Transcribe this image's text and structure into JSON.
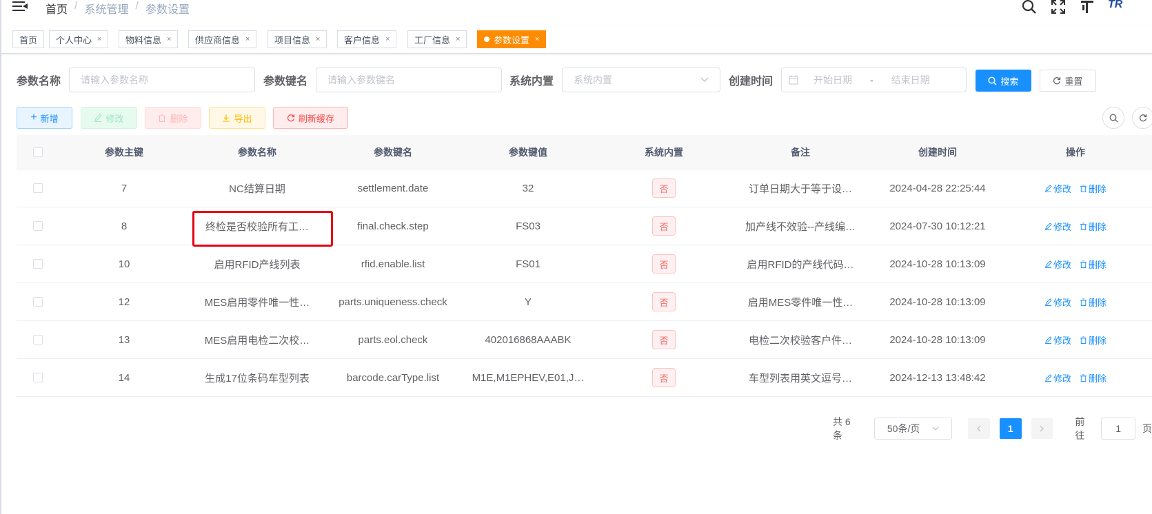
{
  "breadcrumb": {
    "home": "首页",
    "sep": "/",
    "level1": "系统管理",
    "level2": "参数设置"
  },
  "top_icons": [
    "search-icon",
    "fullscreen-icon",
    "font-size-icon"
  ],
  "logo": {
    "text": "TR"
  },
  "tags": [
    {
      "label": "首页",
      "closable": false,
      "active": false
    },
    {
      "label": "个人中心",
      "closable": true,
      "active": false
    },
    {
      "label": "物料信息",
      "closable": true,
      "active": false
    },
    {
      "label": "供应商信息",
      "closable": true,
      "active": false
    },
    {
      "label": "项目信息",
      "closable": true,
      "active": false
    },
    {
      "label": "客户信息",
      "closable": true,
      "active": false
    },
    {
      "label": "工厂信息",
      "closable": true,
      "active": false
    },
    {
      "label": "参数设置",
      "closable": true,
      "active": true
    }
  ],
  "tag_close": "×",
  "filters": {
    "config_name_label": "参数名称",
    "config_name_placeholder": "请输入参数名称",
    "config_key_label": "参数键名",
    "config_key_placeholder": "请输入参数键名",
    "config_type_label": "系统内置",
    "config_type_placeholder": "系统内置",
    "create_time_label": "创建时间",
    "start_date_placeholder": "开始日期",
    "date_sep": "-",
    "end_date_placeholder": "结束日期",
    "search_label": "搜索",
    "reset_label": "重置"
  },
  "toolbar": {
    "add": "新增",
    "edit": "修改",
    "delete": "删除",
    "export": "导出",
    "refresh_cache": "刷新缓存"
  },
  "table": {
    "headers": [
      "参数主键",
      "参数名称",
      "参数键名",
      "参数键值",
      "系统内置",
      "备注",
      "创建时间",
      "操作"
    ],
    "rows": [
      {
        "id": "7",
        "name": "NC结算日期",
        "key": "settlement.date",
        "value": "32",
        "sys": "否",
        "remark": "订单日期大于等于设…",
        "time": "2024-04-28 22:25:44"
      },
      {
        "id": "8",
        "name": "终检是否校验所有工…",
        "key": "final.check.step",
        "value": "FS03",
        "sys": "否",
        "remark": "加产线不效验--产线编…",
        "time": "2024-07-30 10:12:21"
      },
      {
        "id": "10",
        "name": "启用RFID产线列表",
        "key": "rfid.enable.list",
        "value": "FS01",
        "sys": "否",
        "remark": "启用RFID的产线代码…",
        "time": "2024-10-28 10:13:09"
      },
      {
        "id": "12",
        "name": "MES启用零件唯一性…",
        "key": "parts.uniqueness.check",
        "value": "Y",
        "sys": "否",
        "remark": "启用MES零件唯一性…",
        "time": "2024-10-28 10:13:09"
      },
      {
        "id": "13",
        "name": "MES启用电检二次校…",
        "key": "parts.eol.check",
        "value": "402016868AAABK",
        "sys": "否",
        "remark": "电检二次校验客户件…",
        "time": "2024-10-28 10:13:09"
      },
      {
        "id": "14",
        "name": "生成17位条码车型列表",
        "key": "barcode.carType.list",
        "value": "M1E,M1EPHEV,E01,J…",
        "sys": "否",
        "remark": "车型列表用英文逗号…",
        "time": "2024-12-13 13:48:42"
      }
    ],
    "op_edit": "修改",
    "op_delete": "删除"
  },
  "pagination": {
    "total": "共 6 条",
    "page_size": "50条/页",
    "current": "1",
    "goto_prefix": "前往",
    "goto_value": "1",
    "goto_suffix": "页"
  },
  "colors": {
    "primary": "#1890ff",
    "active_tag": "#ff8c00",
    "highlight": "#e60012",
    "danger": "#f56c6c"
  }
}
